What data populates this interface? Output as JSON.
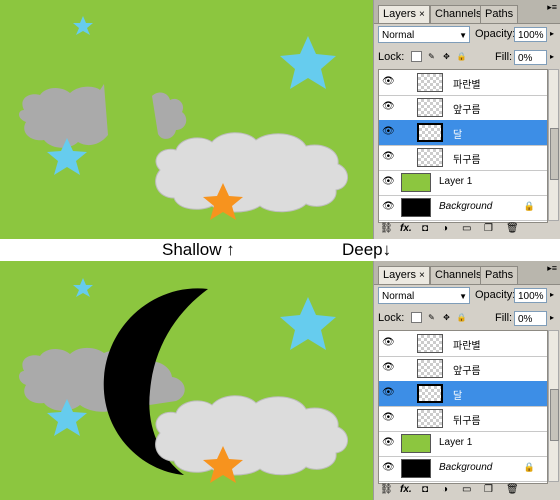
{
  "divider": {
    "shallow": "Shallow ↑",
    "deep": "Deep↓"
  },
  "colors": {
    "canvas_bg": "#8cc63f",
    "star_blue": "#66ccee",
    "star_orange": "#f7931e",
    "cloud_gray": "#aaaaaa",
    "cloud_light": "#dcdcdc",
    "moon": "#000000",
    "selection": "#3d8ee6"
  },
  "panels": [
    {
      "tabs": [
        {
          "label": "Layers",
          "close": "×"
        },
        {
          "label": "Channels"
        },
        {
          "label": "Paths"
        }
      ],
      "blend_mode": "Normal",
      "opacity_label": "Opacity:",
      "opacity_value": "100%",
      "lock_label": "Lock:",
      "fill_label": "Fill:",
      "fill_value": "0%",
      "layers": [
        {
          "name": "파란별",
          "visible": true
        },
        {
          "name": "앞구름",
          "visible": true
        },
        {
          "name": "달",
          "visible": true,
          "selected": true
        },
        {
          "name": "뒤구름",
          "visible": true
        },
        {
          "name": "Layer 1",
          "visible": true
        },
        {
          "name": "Background",
          "visible": true,
          "locked": true
        }
      ],
      "footer_fx": "fx."
    },
    {
      "tabs": [
        {
          "label": "Layers",
          "close": "×"
        },
        {
          "label": "Channels"
        },
        {
          "label": "Paths"
        }
      ],
      "blend_mode": "Normal",
      "opacity_label": "Opacity:",
      "opacity_value": "100%",
      "lock_label": "Lock:",
      "fill_label": "Fill:",
      "fill_value": "0%",
      "layers": [
        {
          "name": "파란별",
          "visible": true
        },
        {
          "name": "앞구름",
          "visible": true
        },
        {
          "name": "달",
          "visible": true,
          "selected": true
        },
        {
          "name": "뒤구름",
          "visible": true
        },
        {
          "name": "Layer 1",
          "visible": true
        },
        {
          "name": "Background",
          "visible": true,
          "locked": true
        }
      ],
      "footer_fx": "fx."
    }
  ]
}
